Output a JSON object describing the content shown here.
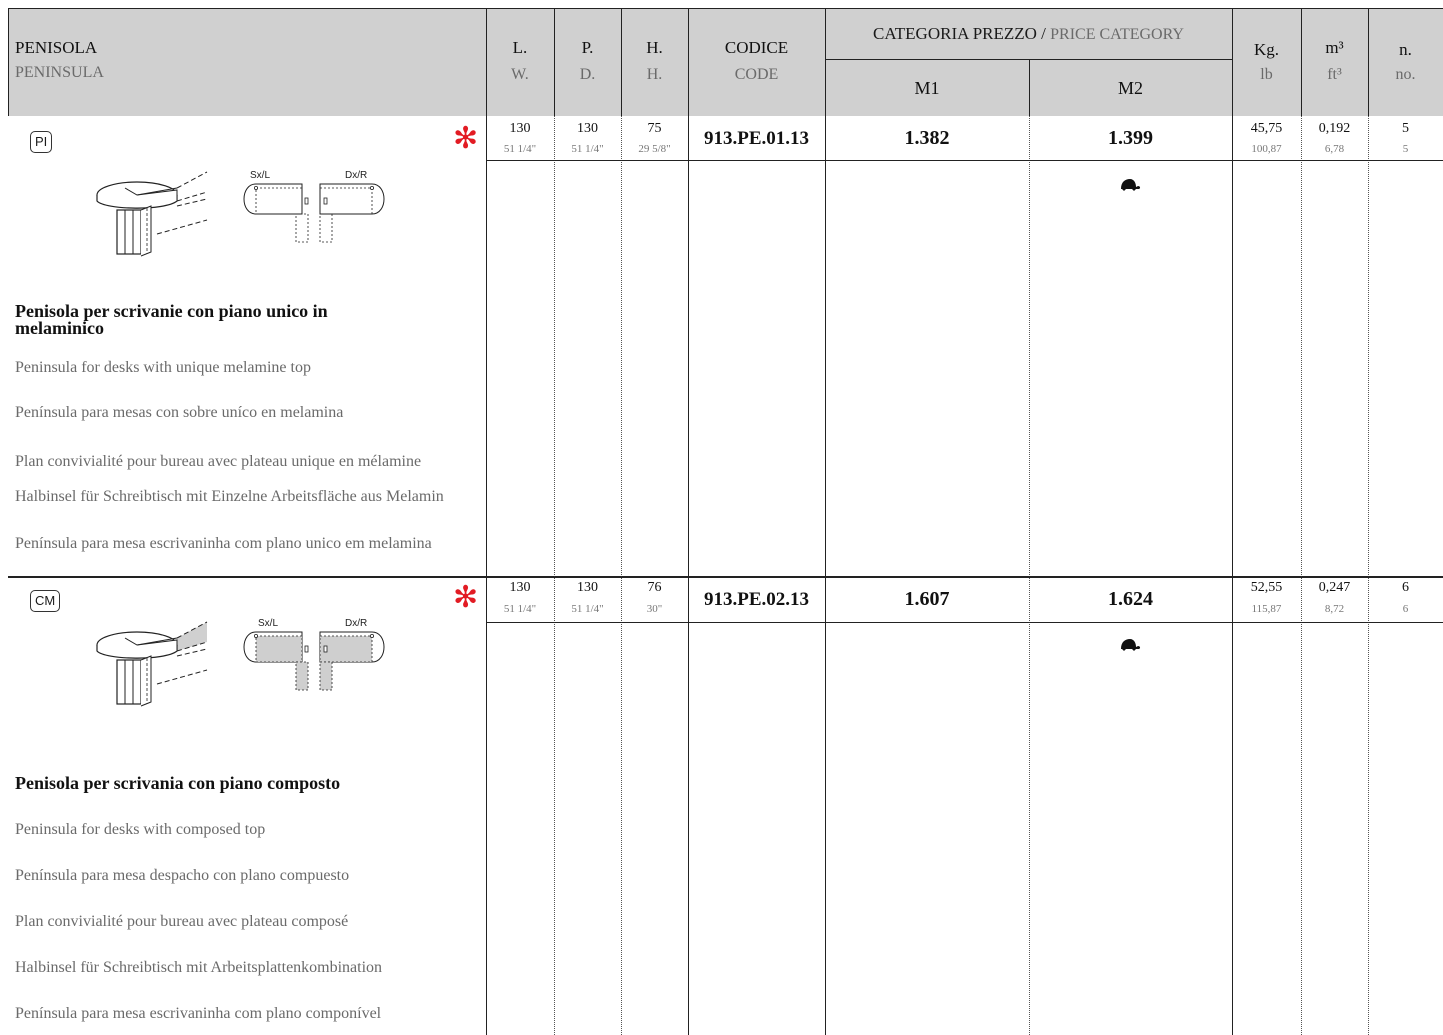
{
  "header": {
    "title": "PENISOLA",
    "title_en": "PENINSULA",
    "col_w_main": "L.",
    "col_w_sub": "W.",
    "col_d_main": "P.",
    "col_d_sub": "D.",
    "col_h_main": "H.",
    "col_h_sub": "H.",
    "col_code_main": "CODICE",
    "col_code_sub": "CODE",
    "price_cat_it": "CATEGORIA PREZZO /",
    "price_cat_en": "PRICE CATEGORY",
    "m1": "M1",
    "m2": "M2",
    "kg_main": "Kg.",
    "kg_sub": "lb",
    "vol_main": "m³",
    "vol_sub": "ft³",
    "n_main": "n.",
    "n_sub": "no."
  },
  "diagram_labels": {
    "left": "Sx/L",
    "right": "Dx/R"
  },
  "products": [
    {
      "tag": "PI",
      "star": "✻",
      "w": "130",
      "w_in": "51 1/4\"",
      "d": "130",
      "d_in": "51 1/4\"",
      "h": "75",
      "h_in": "29 5/8\"",
      "code": "913.PE.01.13",
      "m1": "1.382",
      "m2": "1.399",
      "kg": "45,75",
      "lb": "100,87",
      "m3": "0,192",
      "ft3": "6,78",
      "n": "5",
      "no": "5",
      "desc": [
        "Penisola per scrivanie con piano unico in melaminico",
        "Peninsula for desks with unique melamine top",
        "Península para mesas con sobre uníco en melamina",
        "Plan convivialité pour bureau avec plateau unique en mélamine",
        "Halbinsel für Schreibtisch mit Einzelne Arbeitsfläche aus Melamin",
        "Península para mesa escrivaninha com plano unico em melamina"
      ]
    },
    {
      "tag": "CM",
      "star": "✻",
      "w": "130",
      "w_in": "51 1/4\"",
      "d": "130",
      "d_in": "51 1/4\"",
      "h": "76",
      "h_in": "30\"",
      "code": "913.PE.02.13",
      "m1": "1.607",
      "m2": "1.624",
      "kg": "52,55",
      "lb": "115,87",
      "m3": "0,247",
      "ft3": "8,72",
      "n": "6",
      "no": "6",
      "desc": [
        "Penisola per scrivania con piano composto",
        "Peninsula for desks with composed top",
        "Península para mesa despacho con plano compuesto",
        "Plan convivialité pour bureau avec plateau composé",
        "Halbinsel für Schreibtisch mit Arbeitsplattenkombination",
        "Península para mesa escrivaninha com plano componível"
      ]
    }
  ]
}
